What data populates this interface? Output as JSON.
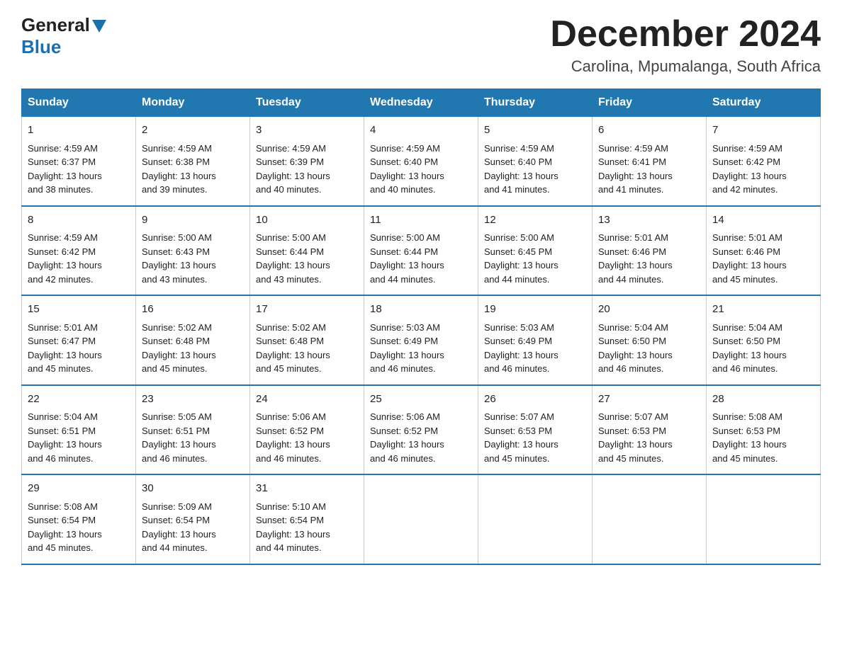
{
  "logo": {
    "general": "General",
    "blue": "Blue"
  },
  "header": {
    "month": "December 2024",
    "location": "Carolina, Mpumalanga, South Africa"
  },
  "days": [
    "Sunday",
    "Monday",
    "Tuesday",
    "Wednesday",
    "Thursday",
    "Friday",
    "Saturday"
  ],
  "weeks": [
    [
      {
        "num": "1",
        "sunrise": "4:59 AM",
        "sunset": "6:37 PM",
        "daylight": "13 hours and 38 minutes."
      },
      {
        "num": "2",
        "sunrise": "4:59 AM",
        "sunset": "6:38 PM",
        "daylight": "13 hours and 39 minutes."
      },
      {
        "num": "3",
        "sunrise": "4:59 AM",
        "sunset": "6:39 PM",
        "daylight": "13 hours and 40 minutes."
      },
      {
        "num": "4",
        "sunrise": "4:59 AM",
        "sunset": "6:40 PM",
        "daylight": "13 hours and 40 minutes."
      },
      {
        "num": "5",
        "sunrise": "4:59 AM",
        "sunset": "6:40 PM",
        "daylight": "13 hours and 41 minutes."
      },
      {
        "num": "6",
        "sunrise": "4:59 AM",
        "sunset": "6:41 PM",
        "daylight": "13 hours and 41 minutes."
      },
      {
        "num": "7",
        "sunrise": "4:59 AM",
        "sunset": "6:42 PM",
        "daylight": "13 hours and 42 minutes."
      }
    ],
    [
      {
        "num": "8",
        "sunrise": "4:59 AM",
        "sunset": "6:42 PM",
        "daylight": "13 hours and 42 minutes."
      },
      {
        "num": "9",
        "sunrise": "5:00 AM",
        "sunset": "6:43 PM",
        "daylight": "13 hours and 43 minutes."
      },
      {
        "num": "10",
        "sunrise": "5:00 AM",
        "sunset": "6:44 PM",
        "daylight": "13 hours and 43 minutes."
      },
      {
        "num": "11",
        "sunrise": "5:00 AM",
        "sunset": "6:44 PM",
        "daylight": "13 hours and 44 minutes."
      },
      {
        "num": "12",
        "sunrise": "5:00 AM",
        "sunset": "6:45 PM",
        "daylight": "13 hours and 44 minutes."
      },
      {
        "num": "13",
        "sunrise": "5:01 AM",
        "sunset": "6:46 PM",
        "daylight": "13 hours and 44 minutes."
      },
      {
        "num": "14",
        "sunrise": "5:01 AM",
        "sunset": "6:46 PM",
        "daylight": "13 hours and 45 minutes."
      }
    ],
    [
      {
        "num": "15",
        "sunrise": "5:01 AM",
        "sunset": "6:47 PM",
        "daylight": "13 hours and 45 minutes."
      },
      {
        "num": "16",
        "sunrise": "5:02 AM",
        "sunset": "6:48 PM",
        "daylight": "13 hours and 45 minutes."
      },
      {
        "num": "17",
        "sunrise": "5:02 AM",
        "sunset": "6:48 PM",
        "daylight": "13 hours and 45 minutes."
      },
      {
        "num": "18",
        "sunrise": "5:03 AM",
        "sunset": "6:49 PM",
        "daylight": "13 hours and 46 minutes."
      },
      {
        "num": "19",
        "sunrise": "5:03 AM",
        "sunset": "6:49 PM",
        "daylight": "13 hours and 46 minutes."
      },
      {
        "num": "20",
        "sunrise": "5:04 AM",
        "sunset": "6:50 PM",
        "daylight": "13 hours and 46 minutes."
      },
      {
        "num": "21",
        "sunrise": "5:04 AM",
        "sunset": "6:50 PM",
        "daylight": "13 hours and 46 minutes."
      }
    ],
    [
      {
        "num": "22",
        "sunrise": "5:04 AM",
        "sunset": "6:51 PM",
        "daylight": "13 hours and 46 minutes."
      },
      {
        "num": "23",
        "sunrise": "5:05 AM",
        "sunset": "6:51 PM",
        "daylight": "13 hours and 46 minutes."
      },
      {
        "num": "24",
        "sunrise": "5:06 AM",
        "sunset": "6:52 PM",
        "daylight": "13 hours and 46 minutes."
      },
      {
        "num": "25",
        "sunrise": "5:06 AM",
        "sunset": "6:52 PM",
        "daylight": "13 hours and 46 minutes."
      },
      {
        "num": "26",
        "sunrise": "5:07 AM",
        "sunset": "6:53 PM",
        "daylight": "13 hours and 45 minutes."
      },
      {
        "num": "27",
        "sunrise": "5:07 AM",
        "sunset": "6:53 PM",
        "daylight": "13 hours and 45 minutes."
      },
      {
        "num": "28",
        "sunrise": "5:08 AM",
        "sunset": "6:53 PM",
        "daylight": "13 hours and 45 minutes."
      }
    ],
    [
      {
        "num": "29",
        "sunrise": "5:08 AM",
        "sunset": "6:54 PM",
        "daylight": "13 hours and 45 minutes."
      },
      {
        "num": "30",
        "sunrise": "5:09 AM",
        "sunset": "6:54 PM",
        "daylight": "13 hours and 44 minutes."
      },
      {
        "num": "31",
        "sunrise": "5:10 AM",
        "sunset": "6:54 PM",
        "daylight": "13 hours and 44 minutes."
      },
      null,
      null,
      null,
      null
    ]
  ],
  "labels": {
    "sunrise": "Sunrise:",
    "sunset": "Sunset:",
    "daylight": "Daylight:"
  }
}
